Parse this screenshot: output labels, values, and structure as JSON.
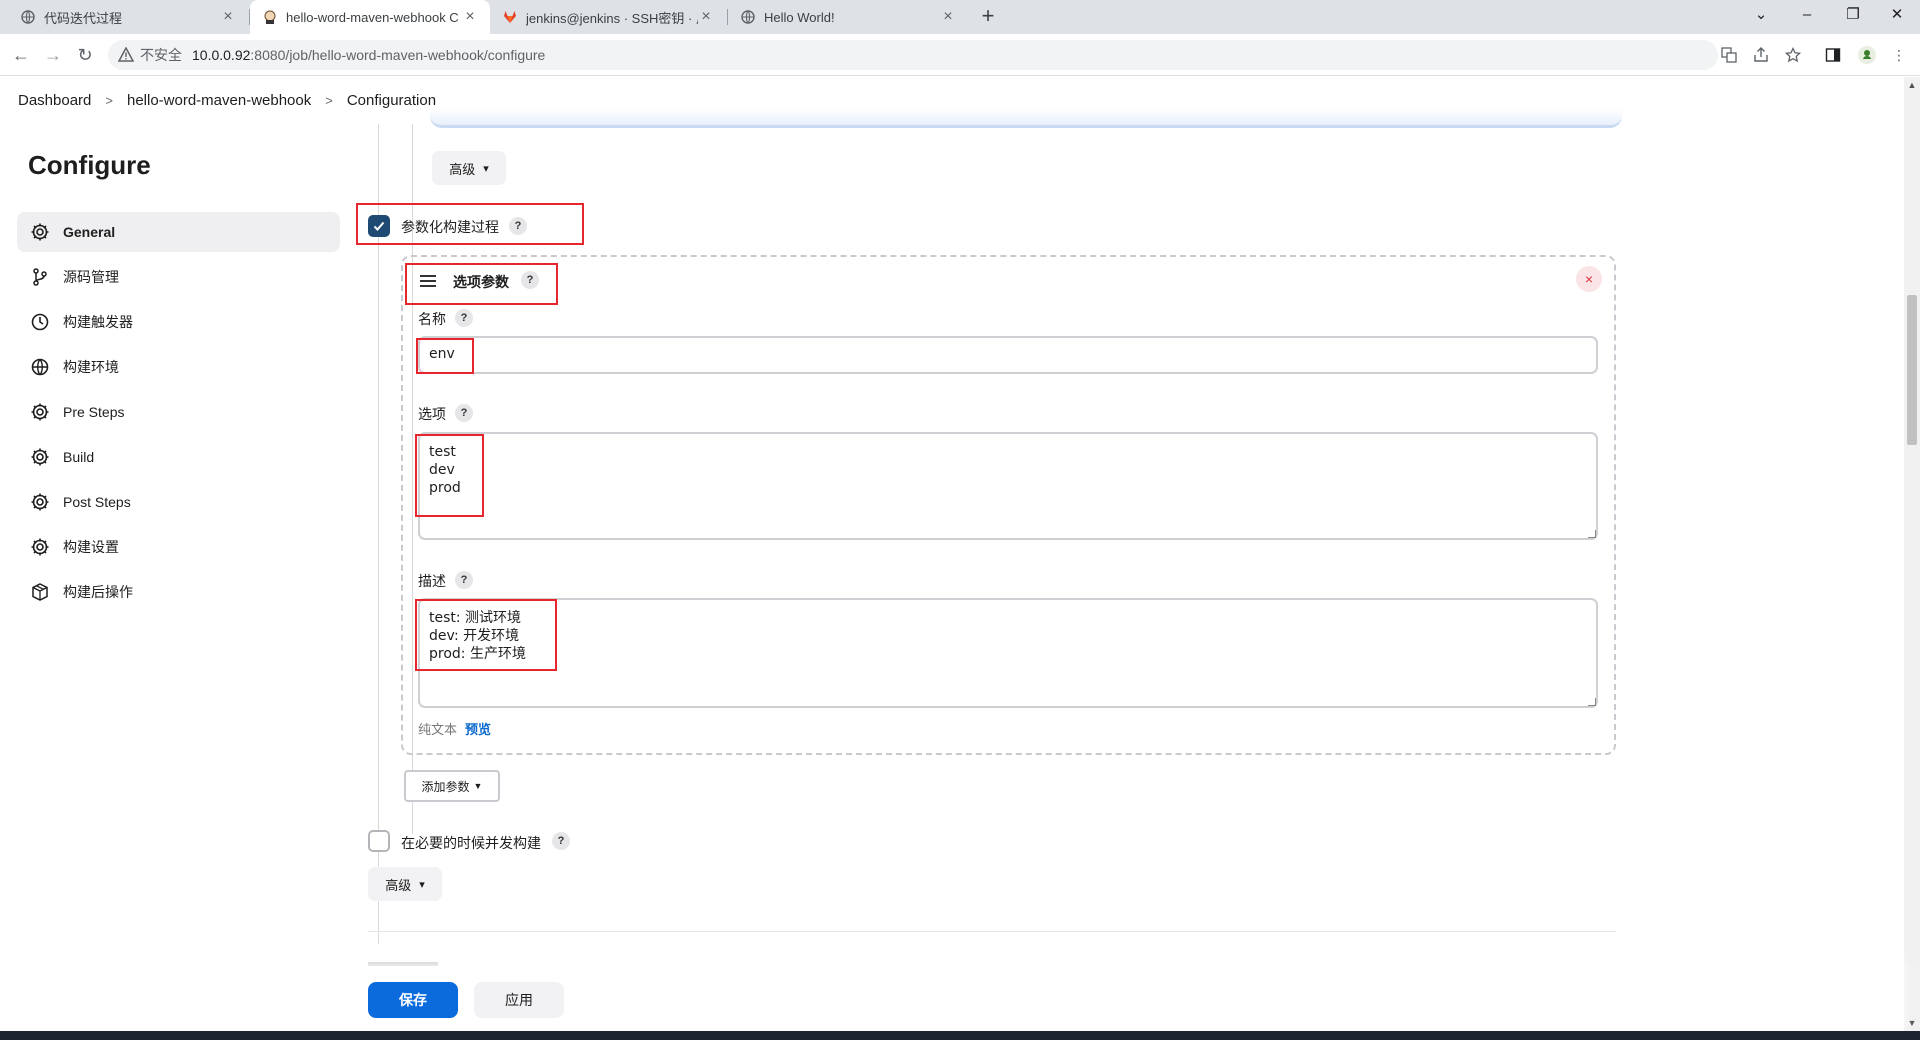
{
  "browser": {
    "tabs": [
      {
        "title": "代码迭代过程",
        "icon": "globe-icon",
        "active": false
      },
      {
        "title": "hello-word-maven-webhook C",
        "icon": "jenkins-icon",
        "active": true
      },
      {
        "title": "jenkins@jenkins · SSH密钥 · 用",
        "icon": "gitlab-icon",
        "active": false
      },
      {
        "title": "Hello World!",
        "icon": "globe-icon",
        "active": false
      }
    ],
    "address": {
      "security_label": "不安全",
      "host": "10.0.0.92",
      "path": ":8080/job/hello-word-maven-webhook/configure"
    }
  },
  "breadcrumb": {
    "items": [
      "Dashboard",
      "hello-word-maven-webhook",
      "Configuration"
    ]
  },
  "sidebar": {
    "title": "Configure",
    "items": [
      {
        "label": "General",
        "icon": "gear-icon",
        "active": true
      },
      {
        "label": "源码管理",
        "icon": "branch-icon"
      },
      {
        "label": "构建触发器",
        "icon": "clock-icon"
      },
      {
        "label": "构建环境",
        "icon": "globe-icon"
      },
      {
        "label": "Pre Steps",
        "icon": "gear-icon"
      },
      {
        "label": "Build",
        "icon": "gear-icon"
      },
      {
        "label": "Post Steps",
        "icon": "gear-icon"
      },
      {
        "label": "构建设置",
        "icon": "gear-icon"
      },
      {
        "label": "构建后操作",
        "icon": "package-icon"
      }
    ]
  },
  "main": {
    "advanced_top_label": "高级",
    "parameterized": {
      "label": "参数化构建过程",
      "checked": true,
      "help": "?"
    },
    "param_card": {
      "title": "选项参数",
      "help": "?",
      "close": "×",
      "name_label": "名称",
      "name_value": "env",
      "choices_label": "选项",
      "choices_value": "test\ndev\nprod",
      "description_label": "描述",
      "description_value": "test: 测试环境\ndev: 开发环境\nprod: 生产环境",
      "format_plain": "纯文本",
      "format_preview": "预览"
    },
    "add_param_label": "添加参数",
    "concurrent": {
      "label": "在必要的时候并发构建",
      "checked": false,
      "help": "?"
    },
    "advanced_bottom_label": "高级"
  },
  "footer": {
    "save_label": "保存",
    "apply_label": "应用"
  },
  "colors": {
    "primary": "#0b6bdc",
    "annotation_red": "#e5262d",
    "checkbox_checked": "#1f4a73"
  }
}
